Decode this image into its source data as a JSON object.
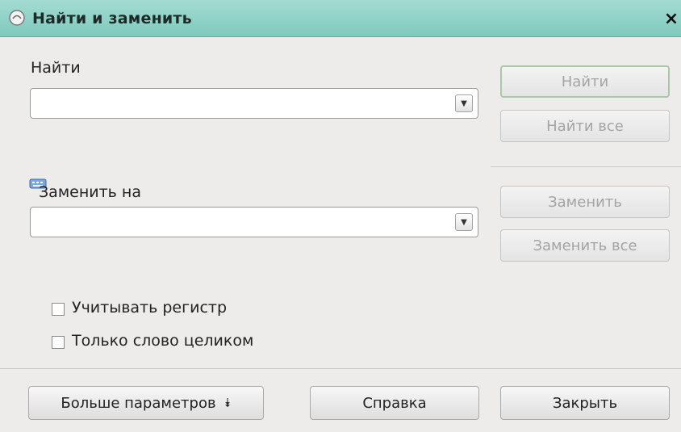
{
  "window": {
    "title": "Найти и заменить",
    "close_symbol": "×"
  },
  "find": {
    "label": "Найти",
    "value": "",
    "arrow": "▼"
  },
  "replace": {
    "label": "Заменить на",
    "value": "",
    "arrow": "▼"
  },
  "buttons": {
    "find": "Найти",
    "find_all": "Найти все",
    "replace": "Заменить",
    "replace_all": "Заменить все",
    "more_options": "Больше параметров",
    "more_arrow": "⯯",
    "help": "Справка",
    "close": "Закрыть"
  },
  "options": {
    "match_case": "Учитывать регистр",
    "whole_words": "Только слово целиком",
    "match_case_checked": false,
    "whole_words_checked": false
  },
  "colors": {
    "titlebar": "#8fd2c7",
    "background": "#edeceb",
    "disabled_text": "#a4a4a4"
  },
  "icons": {
    "app": "app-icon",
    "close": "close-icon",
    "dropdown": "chevron-down-icon",
    "indicator": "input-indicator-icon"
  }
}
